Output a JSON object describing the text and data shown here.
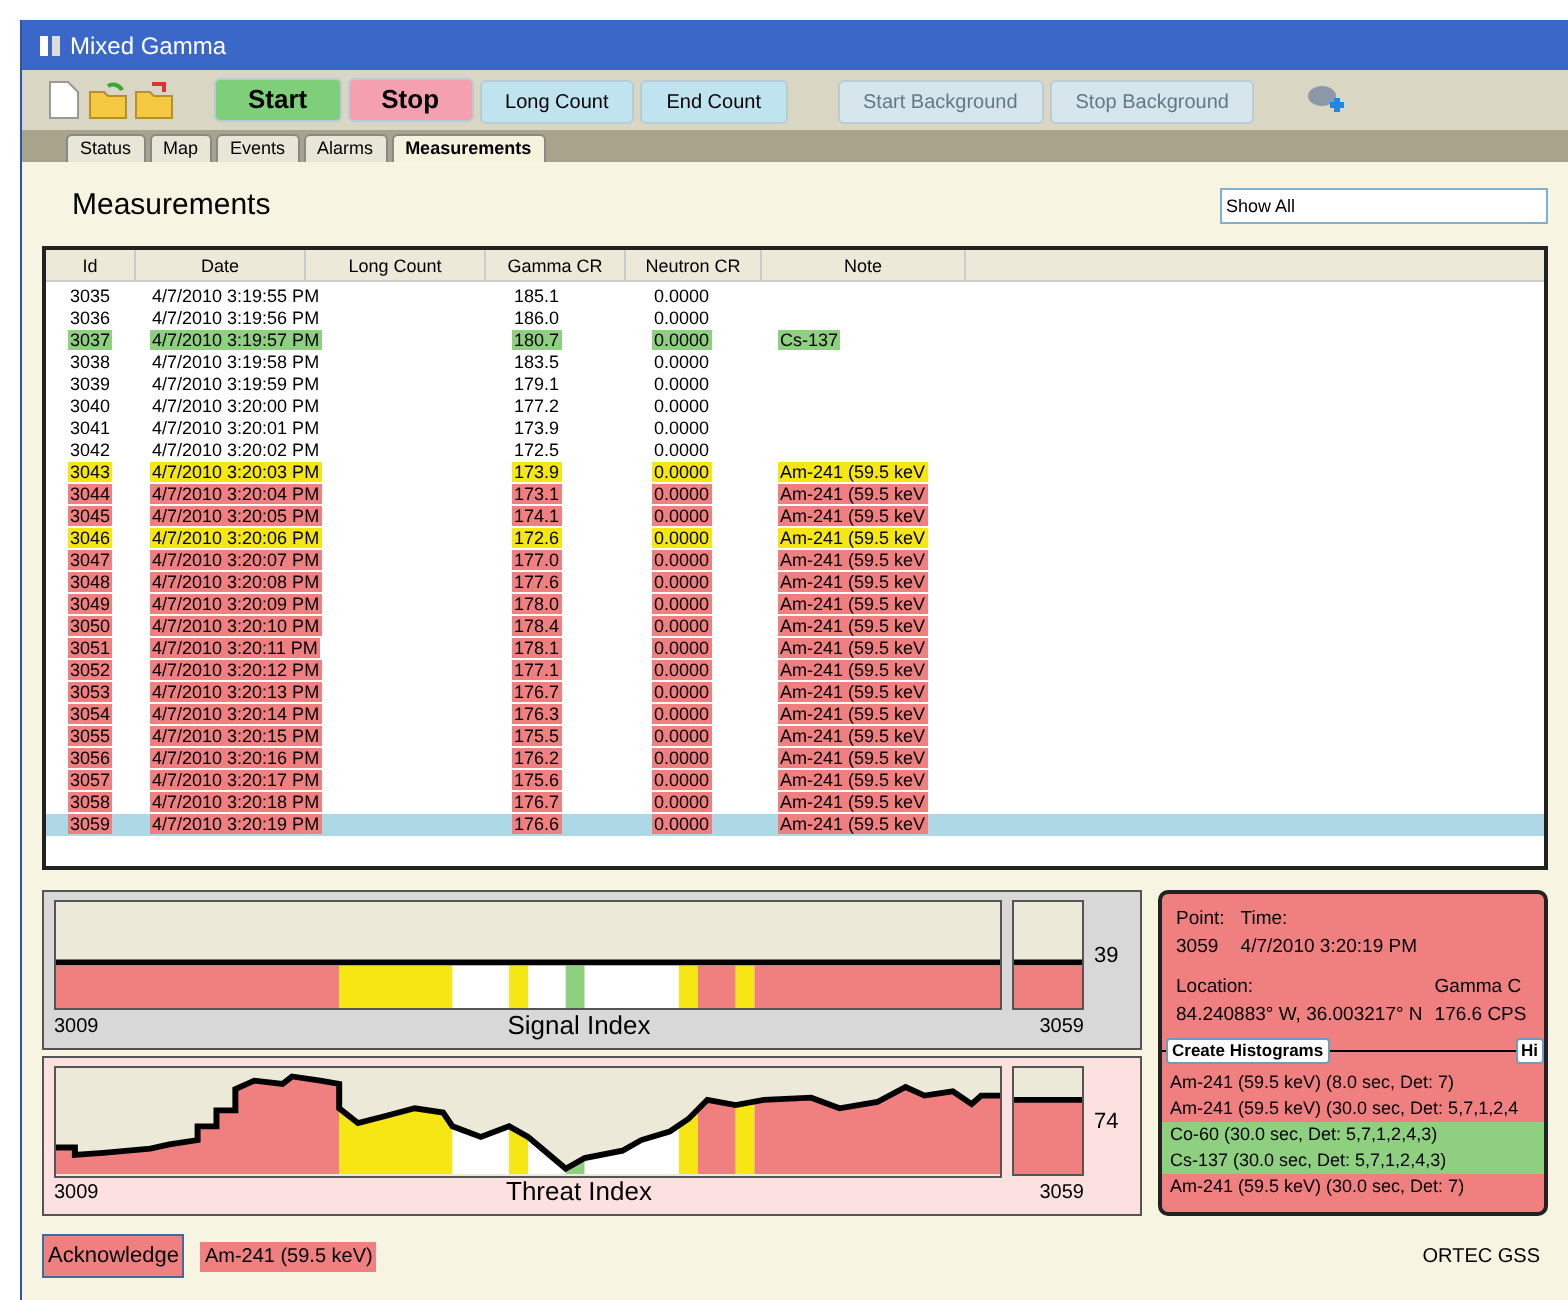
{
  "window": {
    "title": "Mixed Gamma"
  },
  "toolbar": {
    "buttons": [
      {
        "label": "Start",
        "kind": "start",
        "disabled": false
      },
      {
        "label": "Stop",
        "kind": "stop",
        "disabled": false
      },
      {
        "label": "Long Count",
        "kind": "count",
        "disabled": false
      },
      {
        "label": "End Count",
        "kind": "count",
        "disabled": false
      },
      {
        "label": "Start Background",
        "kind": "count",
        "disabled": true
      },
      {
        "label": "Stop Background",
        "kind": "count",
        "disabled": true
      }
    ]
  },
  "tabs": [
    {
      "label": "Status",
      "selected": false
    },
    {
      "label": "Map",
      "selected": false
    },
    {
      "label": "Events",
      "selected": false
    },
    {
      "label": "Alarms",
      "selected": false
    },
    {
      "label": "Measurements",
      "selected": true
    }
  ],
  "heading": "Measurements",
  "filter": {
    "value": "Show All"
  },
  "table": {
    "columns": [
      "Id",
      "Date",
      "Long Count",
      "Gamma CR",
      "Neutron CR",
      "Note"
    ],
    "rows": [
      {
        "id": "3035",
        "date": "4/7/2010 3:19:55 PM",
        "gamma": "185.1",
        "neutron": "0.0000",
        "selected": false
      },
      {
        "id": "3036",
        "date": "4/7/2010 3:19:56 PM",
        "gamma": "186.0",
        "neutron": "0.0000",
        "selected": false
      },
      {
        "id": "3037",
        "date": "4/7/2010 3:19:57 PM",
        "gamma": "180.7",
        "neutron": "0.0000",
        "note": "Cs-137",
        "color": "#8fcf80",
        "selected": false
      },
      {
        "id": "3038",
        "date": "4/7/2010 3:19:58 PM",
        "gamma": "183.5",
        "neutron": "0.0000",
        "selected": false
      },
      {
        "id": "3039",
        "date": "4/7/2010 3:19:59 PM",
        "gamma": "179.1",
        "neutron": "0.0000",
        "selected": false
      },
      {
        "id": "3040",
        "date": "4/7/2010 3:20:00 PM",
        "gamma": "177.2",
        "neutron": "0.0000",
        "selected": false
      },
      {
        "id": "3041",
        "date": "4/7/2010 3:20:01 PM",
        "gamma": "173.9",
        "neutron": "0.0000",
        "selected": false
      },
      {
        "id": "3042",
        "date": "4/7/2010 3:20:02 PM",
        "gamma": "172.5",
        "neutron": "0.0000",
        "selected": false
      },
      {
        "id": "3043",
        "date": "4/7/2010 3:20:03 PM",
        "gamma": "173.9",
        "neutron": "0.0000",
        "note": "Am-241 (59.5 keV",
        "color": "#f5e614",
        "selected": false
      },
      {
        "id": "3044",
        "date": "4/7/2010 3:20:04 PM",
        "gamma": "173.1",
        "neutron": "0.0000",
        "note": "Am-241 (59.5 keV",
        "color": "#f08080",
        "selected": false
      },
      {
        "id": "3045",
        "date": "4/7/2010 3:20:05 PM",
        "gamma": "174.1",
        "neutron": "0.0000",
        "note": "Am-241 (59.5 keV",
        "color": "#f08080",
        "selected": false
      },
      {
        "id": "3046",
        "date": "4/7/2010 3:20:06 PM",
        "gamma": "172.6",
        "neutron": "0.0000",
        "note": "Am-241 (59.5 keV",
        "color": "#f5e614",
        "selected": false
      },
      {
        "id": "3047",
        "date": "4/7/2010 3:20:07 PM",
        "gamma": "177.0",
        "neutron": "0.0000",
        "note": "Am-241 (59.5 keV",
        "color": "#f08080",
        "selected": false
      },
      {
        "id": "3048",
        "date": "4/7/2010 3:20:08 PM",
        "gamma": "177.6",
        "neutron": "0.0000",
        "note": "Am-241 (59.5 keV",
        "color": "#f08080",
        "selected": false
      },
      {
        "id": "3049",
        "date": "4/7/2010 3:20:09 PM",
        "gamma": "178.0",
        "neutron": "0.0000",
        "note": "Am-241 (59.5 keV",
        "color": "#f08080",
        "selected": false
      },
      {
        "id": "3050",
        "date": "4/7/2010 3:20:10 PM",
        "gamma": "178.4",
        "neutron": "0.0000",
        "note": "Am-241 (59.5 keV",
        "color": "#f08080",
        "selected": false
      },
      {
        "id": "3051",
        "date": "4/7/2010 3:20:11 PM",
        "gamma": "178.1",
        "neutron": "0.0000",
        "note": "Am-241 (59.5 keV",
        "color": "#f08080",
        "selected": false
      },
      {
        "id": "3052",
        "date": "4/7/2010 3:20:12 PM",
        "gamma": "177.1",
        "neutron": "0.0000",
        "note": "Am-241 (59.5 keV",
        "color": "#f08080",
        "selected": false
      },
      {
        "id": "3053",
        "date": "4/7/2010 3:20:13 PM",
        "gamma": "176.7",
        "neutron": "0.0000",
        "note": "Am-241 (59.5 keV",
        "color": "#f08080",
        "selected": false
      },
      {
        "id": "3054",
        "date": "4/7/2010 3:20:14 PM",
        "gamma": "176.3",
        "neutron": "0.0000",
        "note": "Am-241 (59.5 keV",
        "color": "#f08080",
        "selected": false
      },
      {
        "id": "3055",
        "date": "4/7/2010 3:20:15 PM",
        "gamma": "175.5",
        "neutron": "0.0000",
        "note": "Am-241 (59.5 keV",
        "color": "#f08080",
        "selected": false
      },
      {
        "id": "3056",
        "date": "4/7/2010 3:20:16 PM",
        "gamma": "176.2",
        "neutron": "0.0000",
        "note": "Am-241 (59.5 keV",
        "color": "#f08080",
        "selected": false
      },
      {
        "id": "3057",
        "date": "4/7/2010 3:20:17 PM",
        "gamma": "175.6",
        "neutron": "0.0000",
        "note": "Am-241 (59.5 keV",
        "color": "#f08080",
        "selected": false
      },
      {
        "id": "3058",
        "date": "4/7/2010 3:20:18 PM",
        "gamma": "176.7",
        "neutron": "0.0000",
        "note": "Am-241 (59.5 keV",
        "color": "#f08080",
        "selected": false
      },
      {
        "id": "3059",
        "date": "4/7/2010 3:20:19 PM",
        "gamma": "176.6",
        "neutron": "0.0000",
        "note": "Am-241 (59.5 keV",
        "color": "#f08080",
        "selected": true
      }
    ]
  },
  "signal_index": {
    "title": "Signal Index",
    "start": "3009",
    "end": "3059",
    "value": "39"
  },
  "threat_index": {
    "title": "Threat Index",
    "start": "3009",
    "end": "3059",
    "value": "74"
  },
  "detail": {
    "point_label": "Point:",
    "point": "3059",
    "time_label": "Time:",
    "time": "4/7/2010 3:20:19 PM",
    "location_label": "Location:",
    "location": "84.240883° W, 36.003217° N",
    "gamma_label": "Gamma C",
    "gamma": "176.6 CPS",
    "buttons": [
      "Create Histograms",
      "Hi"
    ],
    "alarms": [
      {
        "text": "Am-241 (59.5 keV) (8.0 sec, Det: 7)",
        "color": "#f08080"
      },
      {
        "text": "Am-241 (59.5 keV) (30.0 sec, Det: 5,7,1,2,4",
        "color": "#f08080"
      },
      {
        "text": "Co-60 (30.0 sec, Det: 5,7,1,2,4,3)",
        "color": "#8fcf80"
      },
      {
        "text": "Cs-137 (30.0 sec, Det: 5,7,1,2,4,3)",
        "color": "#8fcf80"
      },
      {
        "text": "Am-241 (59.5 keV) (30.0 sec, Det: 7)",
        "color": "#f08080"
      }
    ]
  },
  "status_bar": {
    "acknowledge": "Acknowledge",
    "alarm": "Am-241 (59.5 keV)",
    "version": "ORTEC GSS"
  }
}
